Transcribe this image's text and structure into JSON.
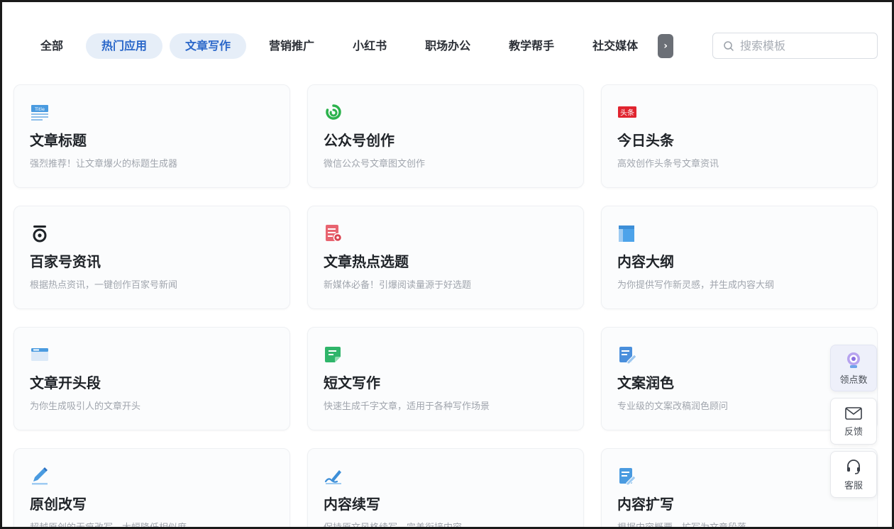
{
  "tabs": [
    {
      "label": "全部",
      "active": false
    },
    {
      "label": "热门应用",
      "active": true
    },
    {
      "label": "文章写作",
      "active": true
    },
    {
      "label": "营销推广",
      "active": false
    },
    {
      "label": "小红书",
      "active": false
    },
    {
      "label": "职场办公",
      "active": false
    },
    {
      "label": "教学帮手",
      "active": false
    },
    {
      "label": "社交媒体",
      "active": false
    }
  ],
  "tabs_more_label": "›",
  "search": {
    "placeholder": "搜索模板",
    "value": ""
  },
  "cards": [
    {
      "title": "文章标题",
      "desc": "强烈推荐！让文章爆火的标题生成器",
      "icon": "title-doc-icon"
    },
    {
      "title": "公众号创作",
      "desc": "微信公众号文章图文创作",
      "icon": "wechat-official-icon"
    },
    {
      "title": "今日头条",
      "desc": "高效创作头条号文章资讯",
      "icon": "toutiao-icon",
      "icon_text": "头条"
    },
    {
      "title": "百家号资讯",
      "desc": "根据热点资讯，一键创作百家号新闻",
      "icon": "baijiahao-icon"
    },
    {
      "title": "文章热点选题",
      "desc": "新媒体必备！引爆阅读量源于好选题",
      "icon": "hot-topic-doc-icon"
    },
    {
      "title": "内容大纲",
      "desc": "为你提供写作新灵感，并生成内容大纲",
      "icon": "outline-icon"
    },
    {
      "title": "文章开头段",
      "desc": "为你生成吸引人的文章开头",
      "icon": "article-opening-icon"
    },
    {
      "title": "短文写作",
      "desc": "快速生成千字文章，适用于各种写作场景",
      "icon": "short-writing-icon"
    },
    {
      "title": "文案润色",
      "desc": "专业级的文案改稿润色顾问",
      "icon": "polish-icon"
    },
    {
      "title": "原创改写",
      "desc": "超越原创的无痕改写，大幅降低相似度",
      "icon": "pen-rewrite-icon"
    },
    {
      "title": "内容续写",
      "desc": "保持原文风格续写，完美衔接内容",
      "icon": "continue-writing-icon"
    },
    {
      "title": "内容扩写",
      "desc": "根据内容概要，扩写为文章段落",
      "icon": "expand-writing-icon"
    }
  ],
  "side": {
    "points_label": "领点数",
    "feedback_label": "反馈",
    "service_label": "客服"
  },
  "colors": {
    "accent": "#2a67c9",
    "tab_active_bg": "#e6eef8",
    "toutiao_red": "#e0242f",
    "wechat_green": "#2bb24c"
  }
}
